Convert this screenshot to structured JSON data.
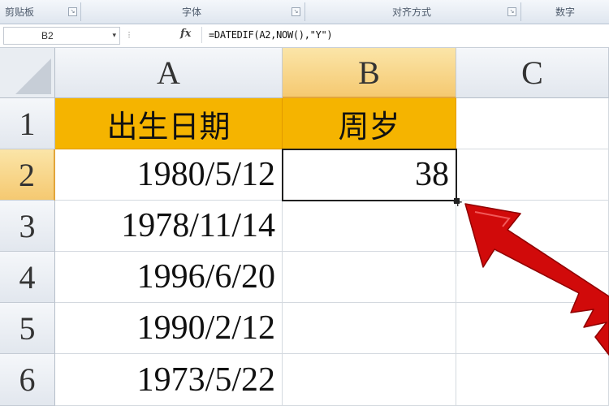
{
  "ribbon": {
    "groups": [
      {
        "label": "剪贴板",
        "launcher": "↘"
      },
      {
        "label": "字体",
        "launcher": "↘"
      },
      {
        "label": "对齐方式",
        "launcher": "↘"
      },
      {
        "label": "数字",
        "launcher": ""
      }
    ]
  },
  "formula_bar": {
    "name_box": "B2",
    "dropdown_icon": "▾",
    "fx_label": "fx",
    "formula": "=DATEDIF(A2,NOW(),\"Y\")"
  },
  "grid": {
    "columns": [
      "A",
      "B",
      "C"
    ],
    "rows": [
      "1",
      "2",
      "3",
      "4",
      "5",
      "6"
    ],
    "cells": {
      "A1": "出生日期",
      "B1": "周岁",
      "A2": "1980/5/12",
      "B2": "38",
      "A3": "1978/11/14",
      "A4": "1996/6/20",
      "A5": "1990/2/12",
      "A6": "1973/5/22"
    },
    "active_cell": "B2"
  },
  "colors": {
    "header_fill": "#f5b400",
    "arrow": "#d10a0a"
  }
}
